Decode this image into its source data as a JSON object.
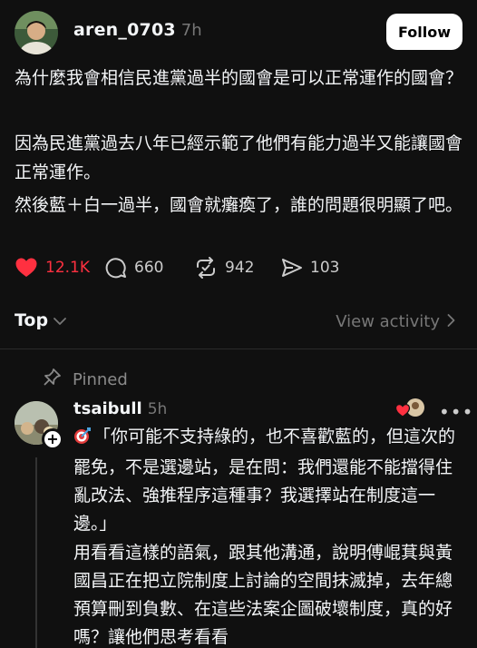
{
  "post": {
    "username": "aren_0703",
    "time": "7h",
    "follow_label": "Follow",
    "paragraphs": [
      "為什麼我會相信民進黨過半的國會是可以正常運作的國會？",
      "因為民進黨過去八年已經示範了他們有能力過半又能讓國會正常運作。",
      "然後藍＋白一過半，國會就癱瘓了，誰的問題很明顯了吧。"
    ],
    "actions": {
      "likes": "12.1K",
      "replies": "660",
      "reposts": "942",
      "shares": "103"
    },
    "like_color": "#ff3040"
  },
  "sort": {
    "label": "Top",
    "view_activity": "View activity"
  },
  "pinned_label": "Pinned",
  "reply": {
    "username": "tsaibull",
    "time": "5h",
    "more_label": "•••",
    "paragraphs": [
      "「你可能不支持綠的，也不喜歡藍的，但這次的罷免，不是選邊站，是在問：我們還能不能擋得住亂改法、強推程序這種事？我選擇站在制度這一邊。」",
      "用看看這樣的語氣，跟其他溝通，說明傅崐萁與黃國昌正在把立院制度上討論的空間抹滅掉，去年總預算刪到負數、在這些法案企圖破壞制度，真的好嗎？讓他們思考看看"
    ]
  }
}
